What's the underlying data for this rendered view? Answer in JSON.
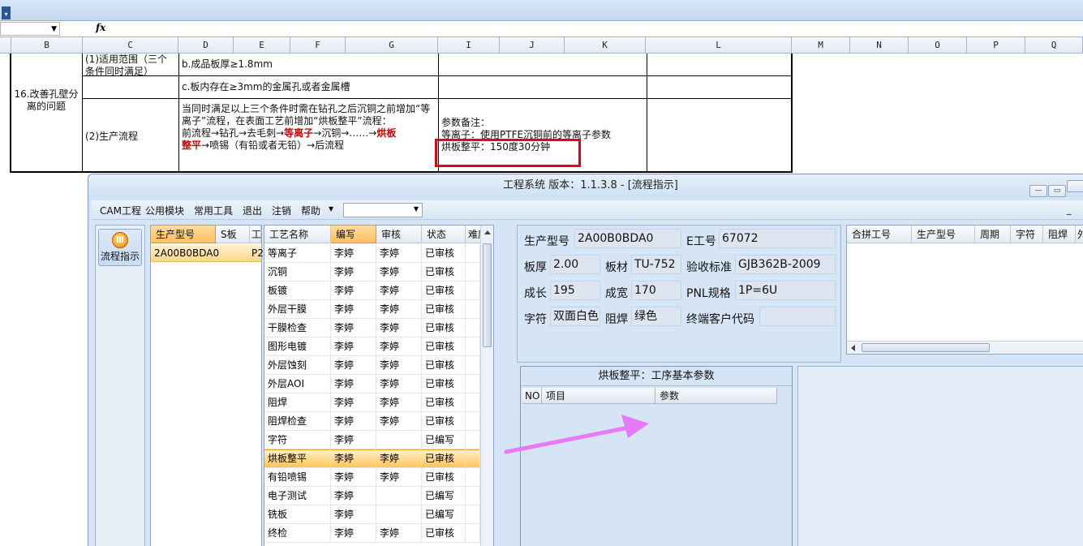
{
  "spreadsheet": {
    "column_headers": [
      "B",
      "C",
      "D",
      "E",
      "F",
      "G",
      "I",
      "J",
      "K",
      "L",
      "M",
      "N",
      "O",
      "P",
      "Q"
    ],
    "item_title": "16.改善孔壁分离的问题",
    "scope_label": "(1)适用范围（三个条件同时满足）",
    "cond_b": "b.成品板厚≥1.8mm",
    "cond_c": "c.板内存在≥3mm的金属孔或者金属槽",
    "flow_label": "(2)生产流程",
    "flow_line1": "当同时满足以上三个条件时需在钻孔之后沉铜之前增加“等离子”流程，在表面工艺前增加“烘板整平”流程：",
    "flow_prefix": "前流程→钻孔→去毛刺→",
    "flow_plasma": "等离子",
    "flow_mid": "→沉铜→……→",
    "flow_bake1": "烘板",
    "flow_bake2": "整平",
    "flow_suffix": "→喷锡（有铅或者无铅）→后流程",
    "note_title": "参数备注：",
    "note_plasma": "等离子：使用PTFE沉铜前的等离子参数",
    "note_bake": "烘板整平：150度30分钟"
  },
  "formula_bar": {
    "fx_label": "fx"
  },
  "app": {
    "title": "工程系统   版本：1.1.3.8 - [流程指示]",
    "window_buttons": {
      "minimize": "—",
      "restore": "▭"
    },
    "menu": [
      "CAM工程",
      "公用模块",
      "常用工具",
      "退出",
      "注销",
      "帮助"
    ],
    "nav_label": "流程指示",
    "prod_grid": {
      "headers": [
        "生产型号",
        "S板",
        "工"
      ],
      "row_model": "2A00B0BDA0",
      "row_trunc": "P2"
    },
    "proc_grid": {
      "headers": [
        "工艺名称",
        "编写",
        "审核",
        "状态",
        "难度"
      ],
      "rows": [
        [
          "等离子",
          "李婷",
          "李婷",
          "已审核"
        ],
        [
          "沉铜",
          "李婷",
          "李婷",
          "已审核"
        ],
        [
          "板镀",
          "李婷",
          "李婷",
          "已审核"
        ],
        [
          "外层干膜",
          "李婷",
          "李婷",
          "已审核"
        ],
        [
          "干膜检查",
          "李婷",
          "李婷",
          "已审核"
        ],
        [
          "图形电镀",
          "李婷",
          "李婷",
          "已审核"
        ],
        [
          "外层蚀刻",
          "李婷",
          "李婷",
          "已审核"
        ],
        [
          "外层AOI",
          "李婷",
          "李婷",
          "已审核"
        ],
        [
          "阻焊",
          "李婷",
          "李婷",
          "已审核"
        ],
        [
          "阻焊检查",
          "李婷",
          "李婷",
          "已审核"
        ],
        [
          "字符",
          "李婷",
          "",
          "已编写"
        ],
        [
          "烘板整平",
          "李婷",
          "李婷",
          "已审核"
        ],
        [
          "有铅喷锡",
          "李婷",
          "李婷",
          "已审核"
        ],
        [
          "电子测试",
          "李婷",
          "",
          "已编写"
        ],
        [
          "铣板",
          "李婷",
          "",
          "已编写"
        ],
        [
          "终检",
          "李婷",
          "李婷",
          "已审核"
        ]
      ],
      "selected_index": 11
    },
    "info": {
      "model_label": "生产型号",
      "model_value": "2A00B0BDA0",
      "e_label": "E工号",
      "e_value": "67072",
      "thick_label": "板厚",
      "thick_value": "2.00",
      "material_label": "板材",
      "material_value": "TU-752",
      "std_label": "验收标准",
      "std_value": "GJB362B-2009",
      "len_label": "成长",
      "len_value": "195",
      "wid_label": "成宽",
      "wid_value": "170",
      "pnl_label": "PNL规格",
      "pnl_value": "1P=6U",
      "char_label": "字符",
      "char_value": "双面白色",
      "mask_label": "阻焊",
      "mask_value": "绿色",
      "cust_label": "终端客户代码",
      "cust_value": ""
    },
    "merge_grid": {
      "headers": [
        "合拼工号",
        "生产型号",
        "周期",
        "字符",
        "阻焊",
        "外"
      ]
    },
    "param_panel": {
      "title": "烘板整平：工序基本参数",
      "headers": [
        "NO",
        "项目",
        "参数"
      ]
    }
  },
  "colors": {
    "highlight_red": "#e3001b",
    "arrow_magenta": "#e879f9",
    "selection_orange": "#ffc45a"
  }
}
